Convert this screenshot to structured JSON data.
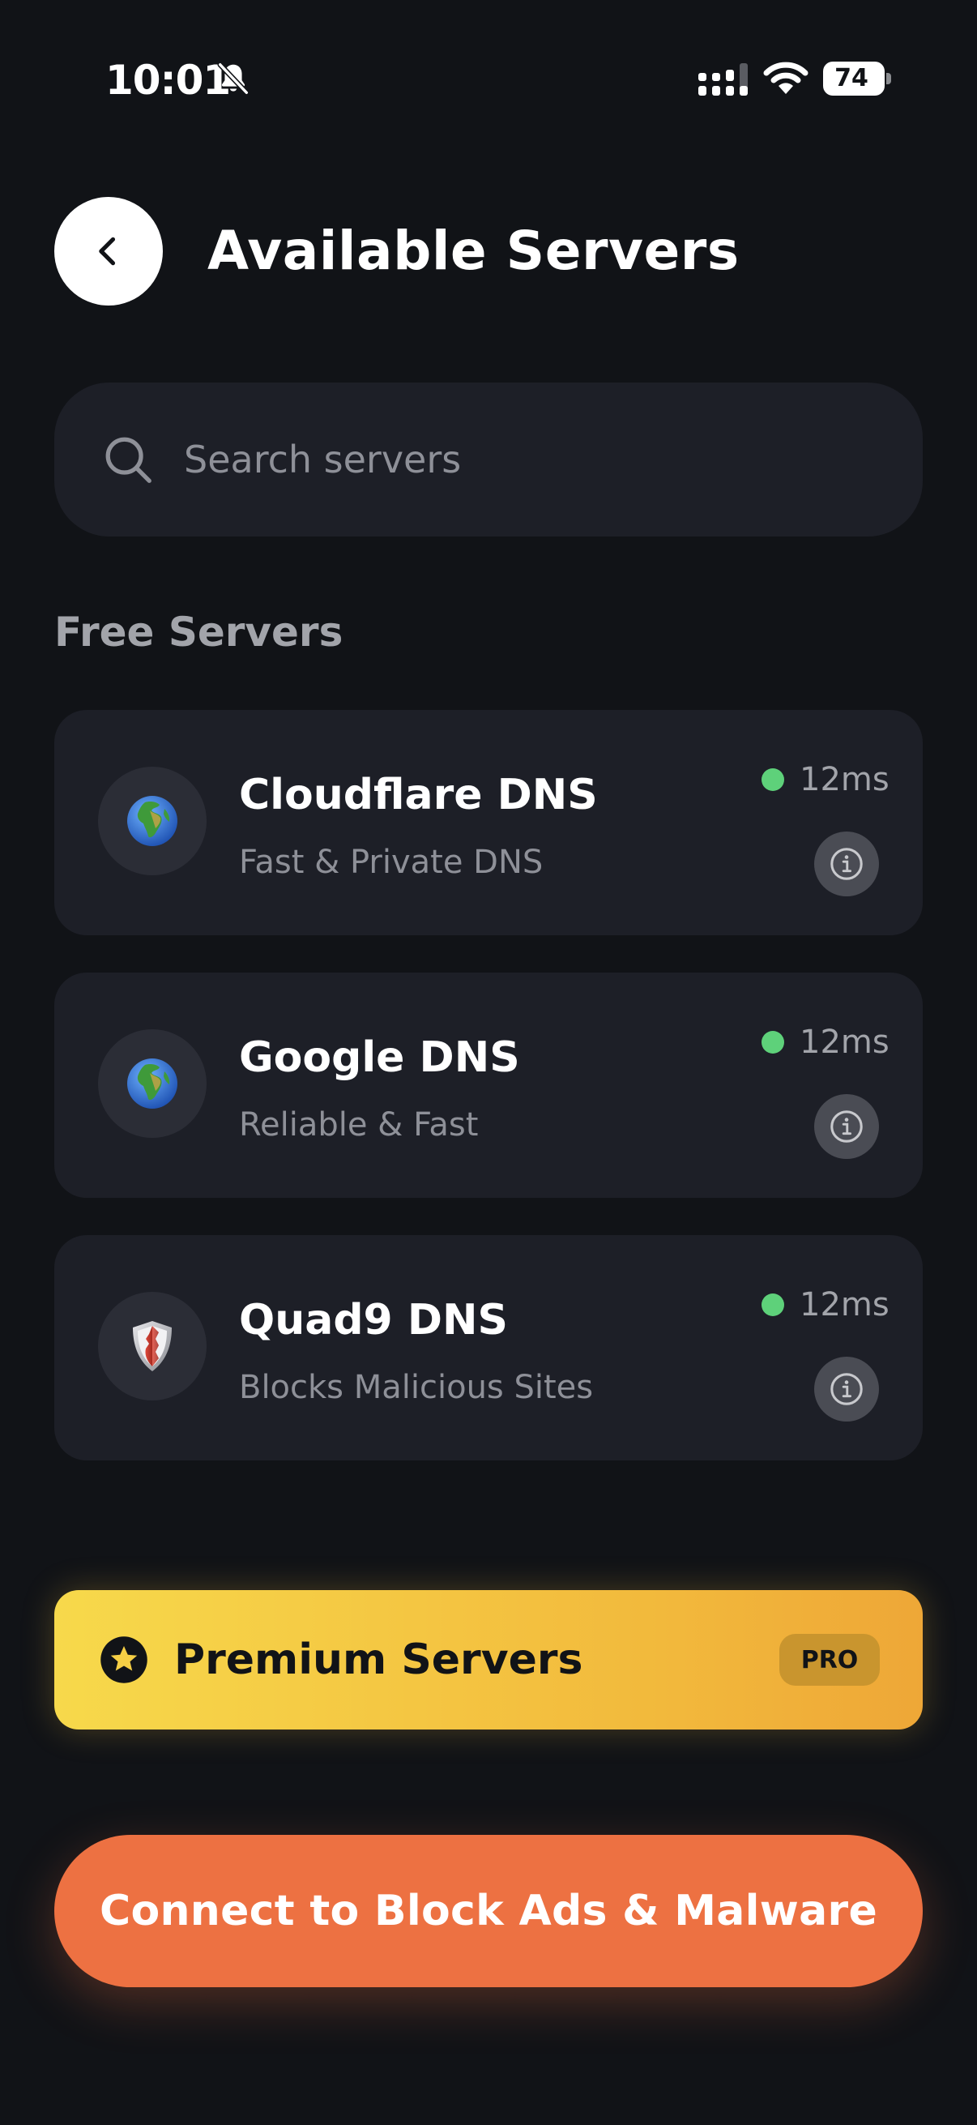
{
  "status_bar": {
    "time": "10:01",
    "bell_icon": "bell-slash-icon",
    "signal_icon": "cellular-signal-icon",
    "wifi_icon": "wifi-icon",
    "battery": "74"
  },
  "header": {
    "back_icon": "chevron-left-icon",
    "title": "Available Servers"
  },
  "search": {
    "icon": "search-icon",
    "placeholder": "Search servers",
    "value": ""
  },
  "free_section": {
    "title": "Free Servers",
    "servers": [
      {
        "name": "Cloudflare DNS",
        "description": "Fast & Private DNS",
        "latency": "12ms",
        "icon": "globe-icon",
        "emoji": "🌍",
        "status_color": "#5ed17a"
      },
      {
        "name": "Google DNS",
        "description": "Reliable & Fast",
        "latency": "12ms",
        "icon": "globe-icon",
        "emoji": "🌍",
        "status_color": "#5ed17a"
      },
      {
        "name": "Quad9 DNS",
        "description": "Blocks Malicious Sites",
        "latency": "12ms",
        "icon": "shield-icon",
        "emoji": "",
        "status_color": "#5ed17a"
      }
    ]
  },
  "premium": {
    "icon": "star-icon",
    "label": "Premium Servers",
    "badge": "PRO"
  },
  "connect": {
    "label": "Connect to Block Ads & Malware"
  },
  "colors": {
    "background": "#111317",
    "card": "#1d1f27",
    "accent_orange": "#ed7142",
    "premium_yellow": "#f7d94b",
    "status_green": "#5ed17a"
  }
}
